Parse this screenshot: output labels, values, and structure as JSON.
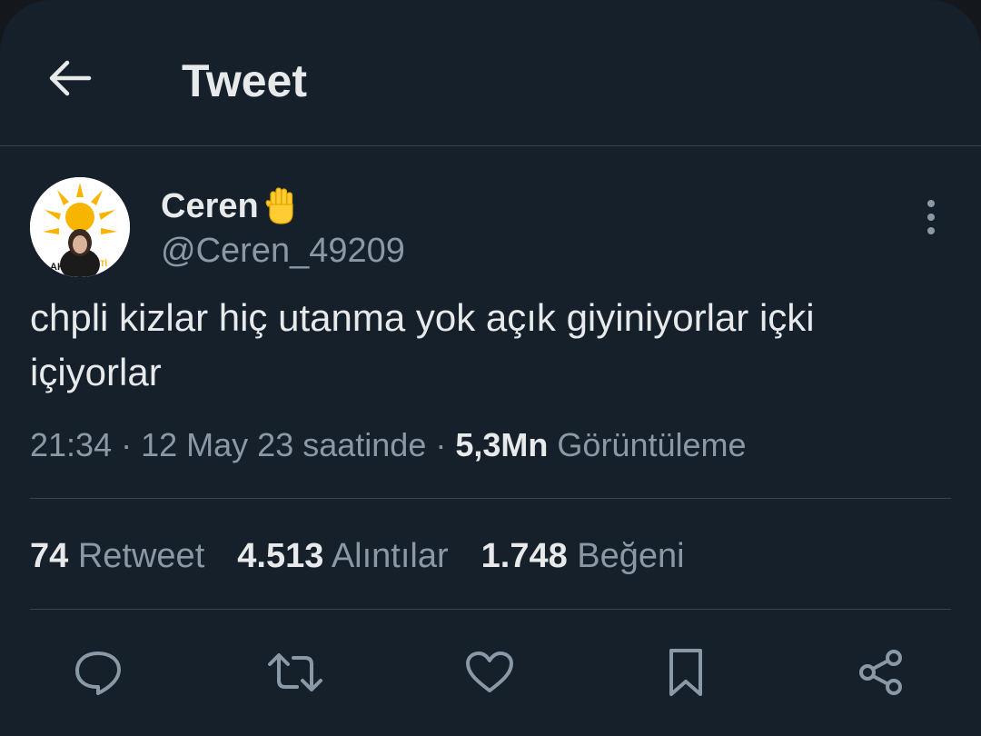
{
  "header": {
    "title": "Tweet",
    "back_icon": "arrow-left-icon"
  },
  "tweet": {
    "author": {
      "display_name": "Ceren",
      "emoji": "raised-hand-icon",
      "handle": "@Ceren_49209"
    },
    "text": "chpli kizlar hiç utanma yok açık giyiniyorlar içki içiyorlar",
    "time": "21:34",
    "separator": "·",
    "date_text": "12 May 23 saatinde",
    "views_count": "5,3Mn",
    "views_label": "Görüntüleme"
  },
  "stats": {
    "retweets_count": "74",
    "retweets_label": "Retweet",
    "quotes_count": "4.513",
    "quotes_label": "Alıntılar",
    "likes_count": "1.748",
    "likes_label": "Beğeni"
  },
  "actions": [
    "reply-icon",
    "retweet-icon",
    "like-icon",
    "bookmark-icon",
    "share-icon"
  ],
  "colors": {
    "background": "#15202b",
    "primary_text": "#e7e9ea",
    "secondary_text": "#8b98a5",
    "divider": "#38444d"
  }
}
